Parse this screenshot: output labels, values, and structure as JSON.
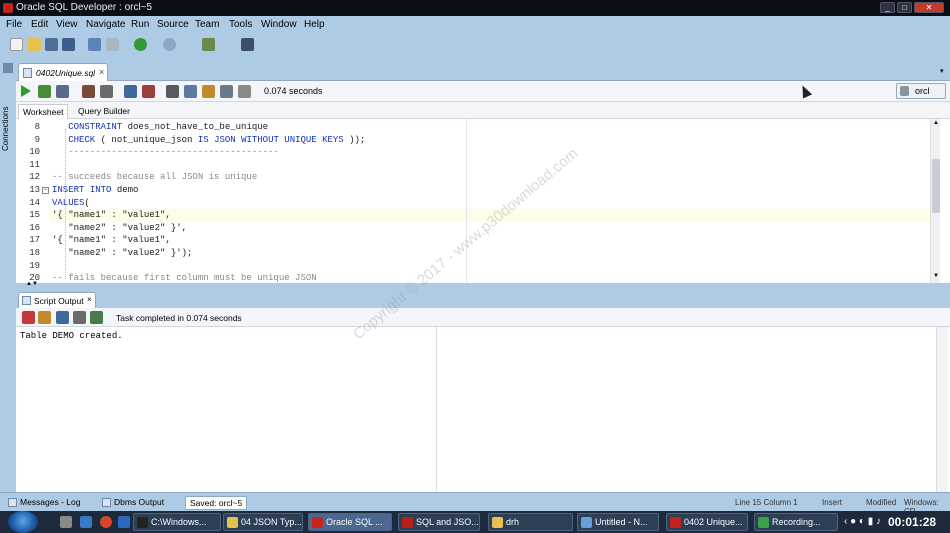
{
  "window": {
    "title": "Oracle SQL Developer : orcl~5"
  },
  "menu": [
    "File",
    "Edit",
    "View",
    "Navigate",
    "Run",
    "Source",
    "Team",
    "Tools",
    "Window",
    "Help"
  ],
  "left_strip": {
    "label": "Connections"
  },
  "editor": {
    "tab_label": "0402Unique.sql",
    "elapsed": "0.074 seconds",
    "connection": "orcl",
    "sub_tabs": [
      "Worksheet",
      "Query Builder"
    ],
    "lines": [
      {
        "num": "8",
        "text": "   CONSTRAINT does_not_have_to_be_unique"
      },
      {
        "num": "9",
        "text": "   CHECK ( not_unique_json IS JSON WITHOUT UNIQUE KEYS ));"
      },
      {
        "num": "10",
        "text": "   ---------------------------------------"
      },
      {
        "num": "11",
        "text": ""
      },
      {
        "num": "12",
        "text": "-- succeeds because all JSON is unique"
      },
      {
        "num": "13",
        "text": "INSERT INTO demo"
      },
      {
        "num": "14",
        "text": "VALUES("
      },
      {
        "num": "15",
        "text": "'{ \"name1\" : \"value1\","
      },
      {
        "num": "16",
        "text": "   \"name2\" : \"value2\" }',"
      },
      {
        "num": "17",
        "text": "'{ \"name1\" : \"value1\","
      },
      {
        "num": "18",
        "text": "   \"name2\" : \"value2\" }');"
      },
      {
        "num": "19",
        "text": ""
      },
      {
        "num": "20",
        "text": "-- fails because first column must be unique JSON"
      }
    ]
  },
  "output": {
    "tab_label": "Script Output",
    "status": "Task completed in 0.074 seconds",
    "text": "Table DEMO created."
  },
  "watermark": "Copyright © 2017 - www.p30download.com",
  "bottom": {
    "tabs": [
      "Messages - Log",
      "Dbms Output"
    ],
    "saved": "Saved: orcl~5",
    "position": "Line 15 Column 1",
    "mode": "Insert",
    "state": "Modified",
    "eol": "Windows: CR"
  },
  "taskbar": {
    "buttons": [
      "C:\\Windows...",
      "04 JSON Typ...",
      "Oracle SQL ...",
      "SQL and JSO...",
      "drh",
      "Untitled - N...",
      "0402 Unique...",
      "Recording..."
    ],
    "clock": "00:01:28"
  }
}
